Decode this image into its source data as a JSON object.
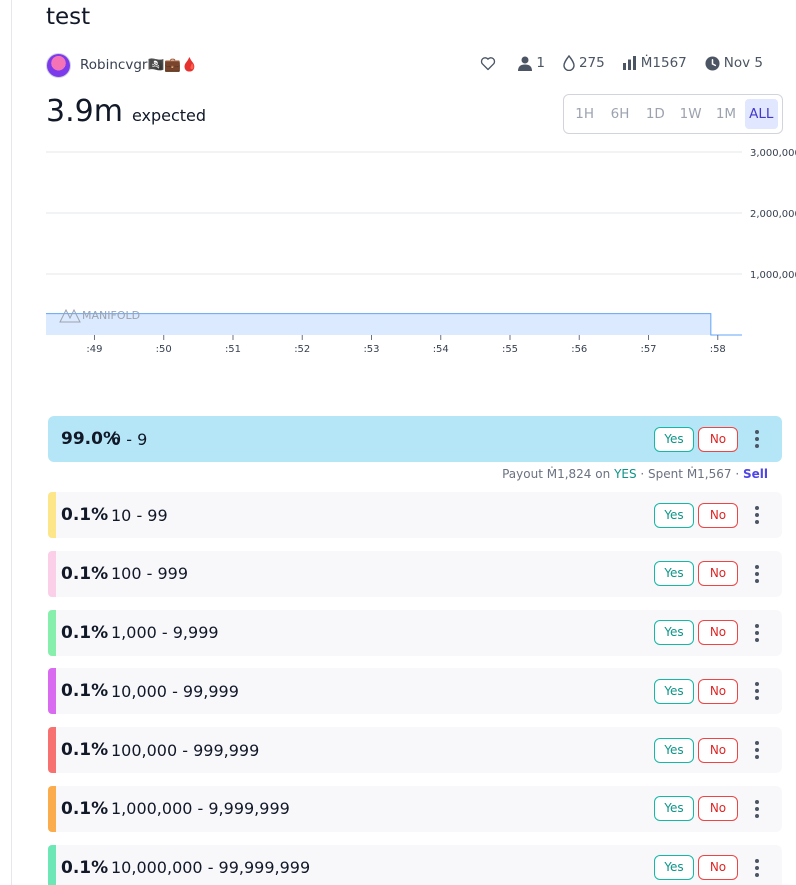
{
  "market": {
    "title": "test",
    "author": "Robincvgr🏴‍☠️💼🩸",
    "stats": {
      "likes": "",
      "traders": "1",
      "tips": "275",
      "volume": "Ṁ1567",
      "close_date": "Nov 5"
    },
    "expected_value": "3.9m",
    "expected_label": "expected"
  },
  "time_range": {
    "options": [
      "1H",
      "6H",
      "1D",
      "1W",
      "1M",
      "ALL"
    ],
    "selected": "ALL"
  },
  "chart_data": {
    "type": "area",
    "watermark": "MANIFOLD",
    "x_ticks": [
      ":49",
      ":50",
      ":51",
      ":52",
      ":53",
      ":54",
      ":55",
      ":56",
      ":57",
      ":58"
    ],
    "y_ticks": [
      "1,000,000",
      "2,000,000",
      "3,000,000"
    ],
    "ylim": [
      0,
      3000000
    ],
    "series": [
      {
        "x": [
          48.3,
          57.9,
          57.9,
          58.35
        ],
        "y": [
          350000,
          350000,
          0,
          0
        ]
      }
    ],
    "colors": {
      "fill": "#dbeafe",
      "line": "#60a5fa",
      "grid": "#e5e7eb"
    }
  },
  "answers": [
    {
      "prob": "99.0%",
      "text": "0 - 9",
      "color": "#b5e6f8",
      "top": true
    },
    {
      "prob": "0.1%",
      "text": "10 - 99",
      "color": "#fde68a"
    },
    {
      "prob": "0.1%",
      "text": "100 - 999",
      "color": "#fbcfe8"
    },
    {
      "prob": "0.1%",
      "text": "1,000 - 9,999",
      "color": "#86efac"
    },
    {
      "prob": "0.1%",
      "text": "10,000 - 99,999",
      "color": "#d86bf0"
    },
    {
      "prob": "0.1%",
      "text": "100,000 - 999,999",
      "color": "#f87171"
    },
    {
      "prob": "0.1%",
      "text": "1,000,000 - 9,999,999",
      "color": "#fbac4d"
    },
    {
      "prob": "0.1%",
      "text": "10,000,000 - 99,999,999",
      "color": "#6ee7b7"
    }
  ],
  "buttons": {
    "yes": "Yes",
    "no": "No"
  },
  "payout": {
    "payout_label": "Payout",
    "payout_amount": "Ṁ1,824",
    "on_label": "on",
    "outcome": "YES",
    "spent_label": "Spent",
    "spent_amount": "Ṁ1,567",
    "sell_label": "Sell"
  }
}
